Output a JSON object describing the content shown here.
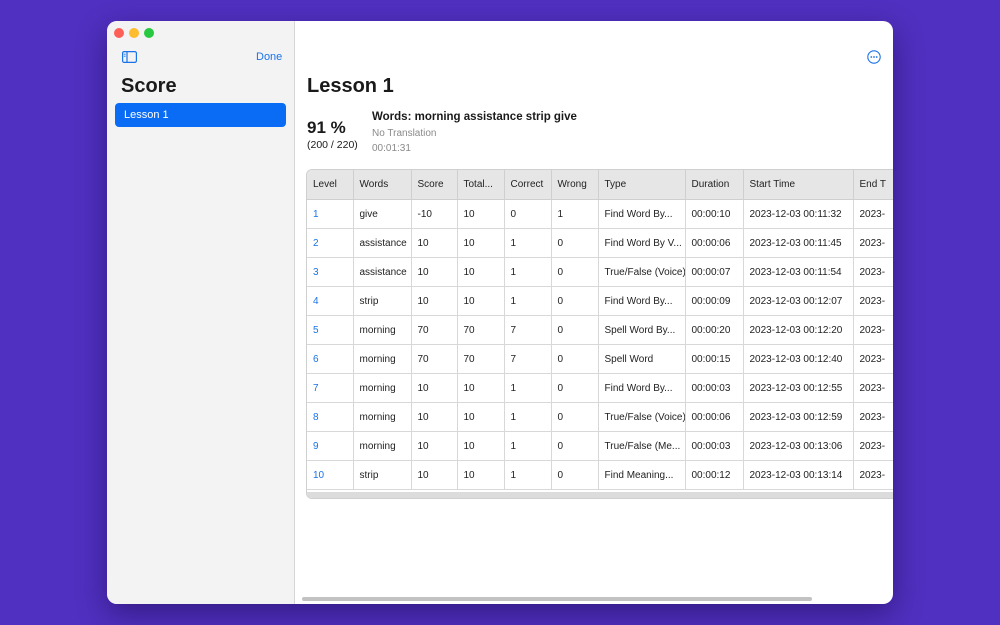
{
  "sidebar": {
    "done_label": "Done",
    "title": "Score",
    "items": [
      {
        "label": "Lesson 1",
        "selected": true
      }
    ]
  },
  "main": {
    "title": "Lesson 1",
    "score_percent": "91 %",
    "score_fraction": "(200 / 220)",
    "words_title": "Words: morning assistance strip give",
    "translation": "No Translation",
    "elapsed": "00:01:31"
  },
  "table": {
    "columns": [
      "Level",
      "Words",
      "Score",
      "Total...",
      "Correct",
      "Wrong",
      "Type",
      "Duration",
      "Start Time",
      "End T"
    ],
    "rows": [
      [
        "1",
        "give",
        "-10",
        "10",
        "0",
        "1",
        "Find Word By...",
        "00:00:10",
        "2023-12-03 00:11:32",
        "2023-"
      ],
      [
        "2",
        "assistance",
        "10",
        "10",
        "1",
        "0",
        "Find Word By V...",
        "00:00:06",
        "2023-12-03 00:11:45",
        "2023-"
      ],
      [
        "3",
        "assistance",
        "10",
        "10",
        "1",
        "0",
        "True/False (Voice)",
        "00:00:07",
        "2023-12-03 00:11:54",
        "2023-"
      ],
      [
        "4",
        "strip",
        "10",
        "10",
        "1",
        "0",
        "Find Word By...",
        "00:00:09",
        "2023-12-03 00:12:07",
        "2023-"
      ],
      [
        "5",
        "morning",
        "70",
        "70",
        "7",
        "0",
        "Spell Word By...",
        "00:00:20",
        "2023-12-03 00:12:20",
        "2023-"
      ],
      [
        "6",
        "morning",
        "70",
        "70",
        "7",
        "0",
        "Spell Word",
        "00:00:15",
        "2023-12-03 00:12:40",
        "2023-"
      ],
      [
        "7",
        "morning",
        "10",
        "10",
        "1",
        "0",
        "Find Word By...",
        "00:00:03",
        "2023-12-03 00:12:55",
        "2023-"
      ],
      [
        "8",
        "morning",
        "10",
        "10",
        "1",
        "0",
        "True/False (Voice)",
        "00:00:06",
        "2023-12-03 00:12:59",
        "2023-"
      ],
      [
        "9",
        "morning",
        "10",
        "10",
        "1",
        "0",
        "True/False (Me...",
        "00:00:03",
        "2023-12-03 00:13:06",
        "2023-"
      ],
      [
        "10",
        "strip",
        "10",
        "10",
        "1",
        "0",
        "Find Meaning...",
        "00:00:12",
        "2023-12-03 00:13:14",
        "2023-"
      ]
    ]
  },
  "colors": {
    "background": "#5030c0",
    "accent": "#0a6cf5",
    "link": "#1a73e8"
  },
  "icons": {
    "sidebar_toggle": "sidebar-toggle-icon",
    "more": "more-ellipsis-icon"
  }
}
